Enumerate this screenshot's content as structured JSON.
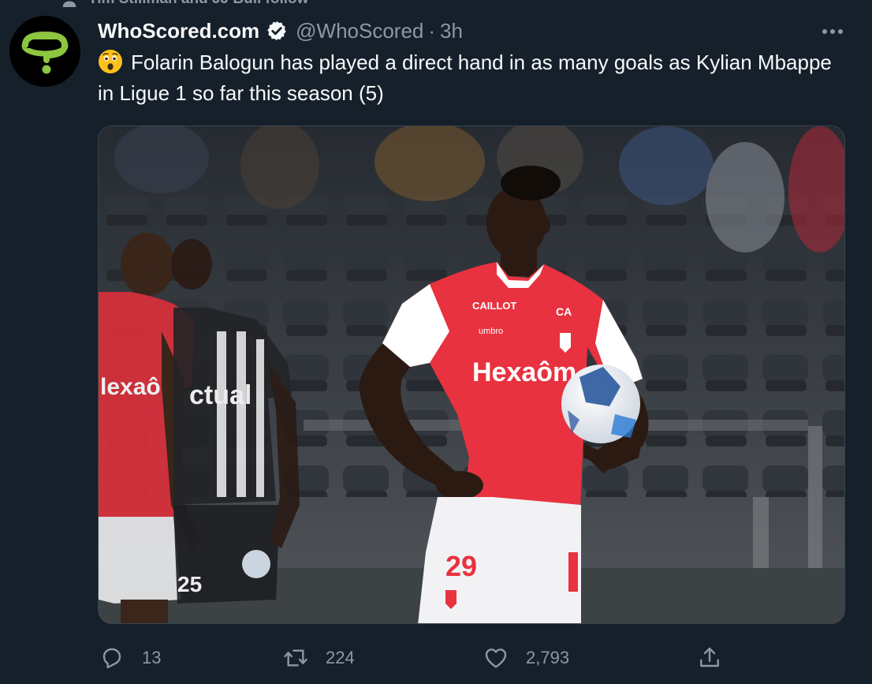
{
  "social_context": {
    "text": "Tim Stillman and JJ Bull follow",
    "icon": "person-icon"
  },
  "tweet": {
    "author": {
      "display_name": "WhoScored.com",
      "verified": true,
      "handle": "@WhoScored",
      "separator": "·",
      "time": "3h",
      "avatar_icon": "whoscored-question-mark-logo",
      "avatar_colors": {
        "background": "#000000",
        "mark": "#8dc63f"
      }
    },
    "emoji": "😯",
    "text": "Folarin Balogun has played a direct hand in as many goals as Kylian Mbappe in Ligue 1 so far this season (5)",
    "media": {
      "player_number": "29",
      "jersey_sponsor": "Hexaôm",
      "opponent_sponsor": "ctual",
      "teammate_sponsor": "lexaôm",
      "teammate_number": "25",
      "kit_maker": "umbro",
      "chest_logo": "CAILLOT",
      "bank_logo": "CA"
    },
    "actions": {
      "reply_count": "13",
      "retweet_count": "224",
      "like_count": "2,793"
    }
  },
  "colors": {
    "background": "#15202b",
    "text_primary": "#f7f9f9",
    "text_secondary": "#8b98a5",
    "border": "#38444d",
    "reims_red": "#e8323f"
  }
}
